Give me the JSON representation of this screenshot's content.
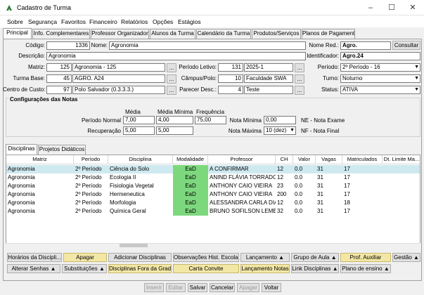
{
  "window": {
    "title": "Cadastro de Turma"
  },
  "menu": [
    "Sobre",
    "Segurança",
    "Favoritos",
    "Financeiro",
    "Relatórios",
    "Opções",
    "Estágios"
  ],
  "tabs": [
    "Principal",
    "Info. Complementares",
    "Professor Organizador",
    "Alunos da Turma",
    "Calendário da Turma",
    "Produtos/Serviços",
    "Planos de Pagamento"
  ],
  "form": {
    "codigo_label": "Código:",
    "codigo": "1336",
    "nome_label": "Nome:",
    "nome": "Agronomia",
    "nome_red_label": "Nome Red.:",
    "nome_red": "Agro.",
    "consultar": "Consultar",
    "descricao_label": "Descrição:",
    "descricao": "Agronomia",
    "identificador_label": "Identificador:",
    "identificador": "Agro.24",
    "matriz_label": "Matriz:",
    "matriz_code": "125",
    "matriz_name": "Agronomia - 125",
    "periodo_letivo_label": "Período Letivo:",
    "periodo_letivo_code": "131",
    "periodo_letivo": "2025-1",
    "periodo_label": "Período:",
    "periodo": "2º Período - 16",
    "turma_base_label": "Turma Base:",
    "turma_base_code": "45",
    "turma_base": "AGRO. A24",
    "campus_label": "Câmpus/Polo:",
    "campus_code": "10",
    "campus": "Faculdade SWA",
    "turno_label": "Turno:",
    "turno": "Noturno",
    "centro_label": "Centro de Custo:",
    "centro_code": "97",
    "centro": "Polo Salvador (0.3.3.3.)",
    "parecer_label": "Parecer Desc.:",
    "parecer_code": "4",
    "parecer": "Teste",
    "status_label": "Status:",
    "status": "ATIVA",
    "dots": "..."
  },
  "config": {
    "title": "Configurações das Notas",
    "media_h": "Média",
    "media_min_h": "Média Mínima",
    "frequencia_h": "Frequência",
    "periodo_normal_label": "Período Normal",
    "periodo_normal_media": "7,00",
    "periodo_normal_min": "4,00",
    "frequencia": "75,00",
    "recuperacao_label": "Recuperação",
    "recuperacao_media": "5,00",
    "recuperacao_min": "5,00",
    "nota_minima_label": "Nota Mínima",
    "nota_minima": "0,00",
    "ne_label": "NE - Nota Exame",
    "nota_maxima_label": "Nota Máxima",
    "nota_maxima": "10 (dez)",
    "nf_label": "NF - Nota Final"
  },
  "subtabs": [
    "Disciplinas",
    "Projetos Didáticos"
  ],
  "grid": {
    "headers": [
      "Matriz",
      "Período",
      "Disciplina",
      "Modalidade",
      "Professor",
      "CH",
      "Valor",
      "Vagas",
      "Matriculados",
      "Dt. Limite Ma..."
    ],
    "rows": [
      [
        "Agronomia",
        "2º Período",
        "Ciência do Solo",
        "EaD",
        "A CONFIRMAR",
        "12",
        "0.0",
        "31",
        "17",
        ""
      ],
      [
        "Agronomia",
        "2º Período",
        "Ecologia II",
        "EaD",
        "ANIND FLÁVIA TORRADO",
        "12",
        "0.0",
        "31",
        "17",
        ""
      ],
      [
        "Agronomia",
        "2º Período",
        "Fisiologia Vegetal",
        "EaD",
        "ANTHONY CAIO VIEIRA",
        "23",
        "0.0",
        "31",
        "17",
        ""
      ],
      [
        "Agronomia",
        "2º Período",
        "Hermeneutica",
        "EaD",
        "ANTHONY CAIO VIEIRA",
        "200",
        "0.0",
        "31",
        "17",
        ""
      ],
      [
        "Agronomia",
        "2º Período",
        "Morfologia",
        "EaD",
        "ALESSANDRA CARLA DIAS",
        "12",
        "0.0",
        "31",
        "18",
        ""
      ],
      [
        "Agronomia",
        "2º Período",
        "Química Geral",
        "EaD",
        "BRUNO SOFILSON LEMES",
        "32",
        "0.0",
        "31",
        "17",
        ""
      ]
    ]
  },
  "actions": {
    "row1": [
      "Horários da Discipli...",
      "Apagar",
      "Adicionar Disciplinas",
      "Observações Hist. Escolar",
      "Lançamento",
      "Grupo de Aula",
      "Prof. Auxiliar",
      "Gestão"
    ],
    "row2": [
      "Alterar Senhas",
      "Substituições",
      "Disciplinas Fora da Grade",
      "Carta Convite",
      "Lançamento Notas",
      "Link Disciplinas",
      "Plano de ensino"
    ]
  },
  "footer": [
    "Inserir",
    "Editar",
    "Salvar",
    "Cancelar",
    "Apagar",
    "Voltar"
  ],
  "colors": {
    "ead": "#7dd87d",
    "selected_row": "#cfe9f0",
    "yellow_button": "#f3e7a6"
  }
}
